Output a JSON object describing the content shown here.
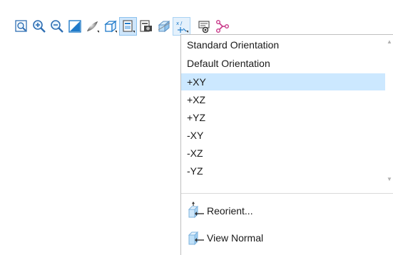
{
  "toolbar": {
    "buttons": [
      {
        "icon": "zoom-fit-icon"
      },
      {
        "icon": "zoom-in-icon"
      },
      {
        "icon": "zoom-out-icon"
      },
      {
        "icon": "repaint-icon"
      },
      {
        "icon": "display-style-icon"
      },
      {
        "icon": "named-views-icon"
      },
      {
        "icon": "saved-orientations-icon"
      },
      {
        "icon": "view-manager-icon"
      },
      {
        "icon": "section-view-icon"
      },
      {
        "icon": "datum-display-icon"
      },
      {
        "icon": "annotation-display-icon"
      },
      {
        "icon": "spin-center-icon"
      }
    ],
    "active_button": "saved-orientations-icon",
    "highlighted_button": "datum-display-icon"
  },
  "orientation_menu": {
    "items": [
      {
        "label": "Standard Orientation"
      },
      {
        "label": "Default Orientation"
      },
      {
        "label": "+XY"
      },
      {
        "label": "+XZ"
      },
      {
        "label": "+YZ"
      },
      {
        "label": "-XY"
      },
      {
        "label": "-XZ"
      },
      {
        "label": "-YZ"
      }
    ],
    "selected": "+XY",
    "actions": [
      {
        "label": "Reorient...",
        "icon": "reorient-icon"
      },
      {
        "label": "View Normal",
        "icon": "view-normal-icon"
      }
    ]
  },
  "colors": {
    "selection": "#cce8ff",
    "accent": "#1f7ac9"
  }
}
